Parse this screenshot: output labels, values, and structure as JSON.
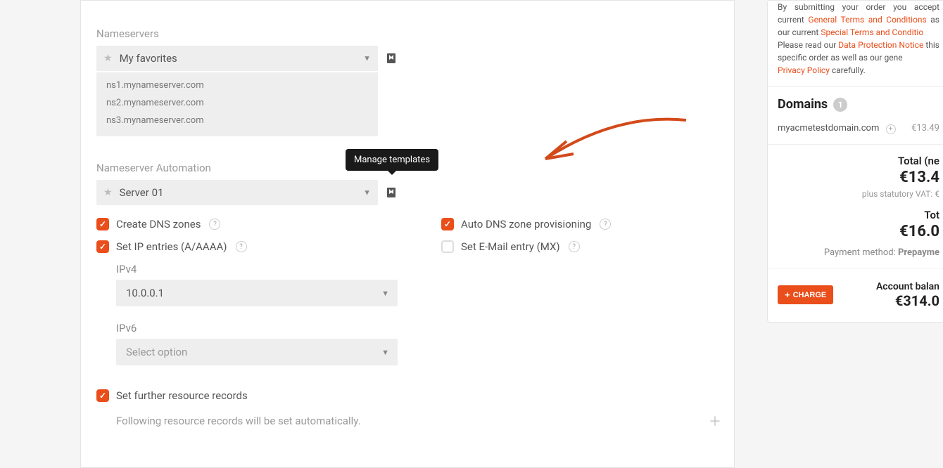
{
  "nameservers": {
    "label": "Nameservers",
    "selected": "My favorites",
    "items": [
      "ns1.mynameserver.com",
      "ns2.mynameserver.com",
      "ns3.mynameserver.com"
    ]
  },
  "automation": {
    "label": "Nameserver Automation",
    "selected": "Server 01",
    "tooltip": "Manage templates"
  },
  "checks": {
    "create_dns": "Create DNS zones",
    "set_ip": "Set IP entries (A/AAAA)",
    "auto_dns": "Auto DNS zone provisioning",
    "set_email": "Set E-Mail entry (MX)"
  },
  "ip": {
    "v4_label": "IPv4",
    "v4_value": "10.0.0.1",
    "v6_label": "IPv6",
    "v6_placeholder": "Select option"
  },
  "further": {
    "label": "Set further resource records",
    "note": "Following resource records will be set automatically."
  },
  "legal": {
    "line1": "By submitting your order you accept ",
    "line1b": "current ",
    "gtc": "General Terms and Conditions",
    "line2": " as our current ",
    "stc": "Special Terms and Conditio",
    "line3": "Please read our ",
    "dpn": "Data Protection Notice",
    "line4": " this specific order as well as our gene",
    "pp": "Privacy Policy",
    "line5": " carefully."
  },
  "domains": {
    "header": "Domains",
    "count": "1",
    "name": "myacmetestdomain.com",
    "price": "€13.49"
  },
  "totals": {
    "net_label": "Total (ne",
    "net_amount": "€13.4",
    "vat_note": "plus statutory VAT: €",
    "tot_label": "Tot",
    "tot_amount": "€16.0",
    "paym_label": "Payment method: ",
    "paym_val": "Prepayme"
  },
  "balance": {
    "charge": "CHARGE",
    "label": "Account balan",
    "amount": "€314.0"
  }
}
